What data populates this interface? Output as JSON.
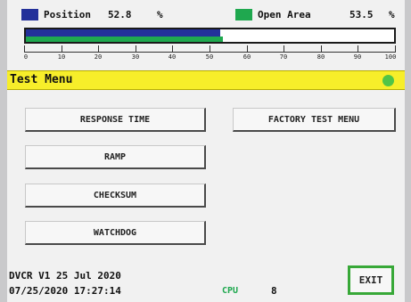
{
  "colors": {
    "position": "#23309a",
    "open_area": "#1fa84f",
    "menu_bar": "#f7ee2a",
    "status_led": "#51c447",
    "exit_border": "#38a838"
  },
  "legend": {
    "position": {
      "label": "Position",
      "value": "52.8",
      "unit": "%"
    },
    "open_area": {
      "label": "Open Area",
      "value": "53.5",
      "unit": "%"
    }
  },
  "bar": {
    "position_percent": 52.8,
    "open_area_percent": 53.5
  },
  "scale": {
    "ticks": [
      "0",
      "10",
      "20",
      "30",
      "40",
      "50",
      "60",
      "70",
      "80",
      "90",
      "100"
    ]
  },
  "menu": {
    "title": "Test Menu",
    "status_icon": "status-led-icon"
  },
  "buttons": {
    "response_time": "RESPONSE TIME",
    "ramp": "RAMP",
    "checksum": "CHECKSUM",
    "watchdog": "WATCHDOG",
    "factory_test_menu": "FACTORY TEST MENU"
  },
  "footer": {
    "version": "DVCR V1 25 Jul 2020",
    "datetime": "07/25/2020 17:27:14",
    "cpu_label": "CPU",
    "cpu_value": "8",
    "exit_label": "EXIT"
  }
}
